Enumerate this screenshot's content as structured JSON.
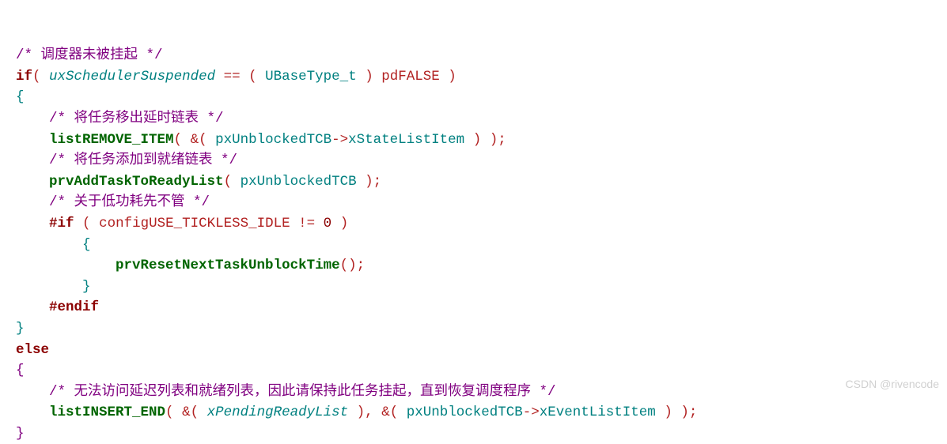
{
  "code": {
    "c1": "/* 调度器未被挂起 */",
    "kw_if": "if",
    "p_open1": "(",
    "id_uxSched": "uxSchedulerSuspended",
    "op_eq": "==",
    "p_open2": "(",
    "type_ubase": "UBaseType_t",
    "p_close2": ")",
    "pdfalse": "pdFALSE",
    "p_close1": ")",
    "brace_open1": "{",
    "c2": "/* 将任务移出延时链表 */",
    "fn_listRemove": "listREMOVE_ITEM",
    "p_o3": "(",
    "amp1": "&(",
    "id_pxUnblk": "pxUnblockedTCB",
    "arrow1": "->",
    "mem_xstate": "xStateListItem",
    "p_c3a": ")",
    "p_c3b": ")",
    "semi1": ";",
    "c3": "/* 将任务添加到就绪链表 */",
    "fn_prvAdd": "prvAddTaskToReadyList",
    "p_o4": "(",
    "id_pxUnblk2": "pxUnblockedTCB",
    "p_c4": ")",
    "semi2": ";",
    "c4": "/* 关于低功耗先不管 */",
    "pp_if": "#if",
    "p_o5": "(",
    "cfg_tickless": "configUSE_TICKLESS_IDLE",
    "neq": "!=",
    "zero": "0",
    "p_c5": ")",
    "brace_open2": "{",
    "fn_prvReset": "prvResetNextTaskUnblockTime",
    "p_o6": "(",
    "p_c6": ")",
    "semi3": ";",
    "brace_close2": "}",
    "pp_endif": "#endif",
    "brace_close1": "}",
    "kw_else": "else",
    "brace_open3": "{",
    "c5": "/* 无法访问延迟列表和就绪列表，因此请保持此任务挂起，直到恢复调度程序 */",
    "fn_listInsert": "listINSERT_END",
    "p_o7": "(",
    "amp2": "&(",
    "id_pending": "xPendingReadyList",
    "p_c7a": ")",
    "comma": ",",
    "amp3": "&(",
    "id_pxUnblk3": "pxUnblockedTCB",
    "arrow2": "->",
    "mem_xEvent": "xEventListItem",
    "p_c7b": ")",
    "p_c7c": ")",
    "semi4": ";",
    "brace_close3": "}"
  },
  "watermark": "CSDN @rivencode"
}
